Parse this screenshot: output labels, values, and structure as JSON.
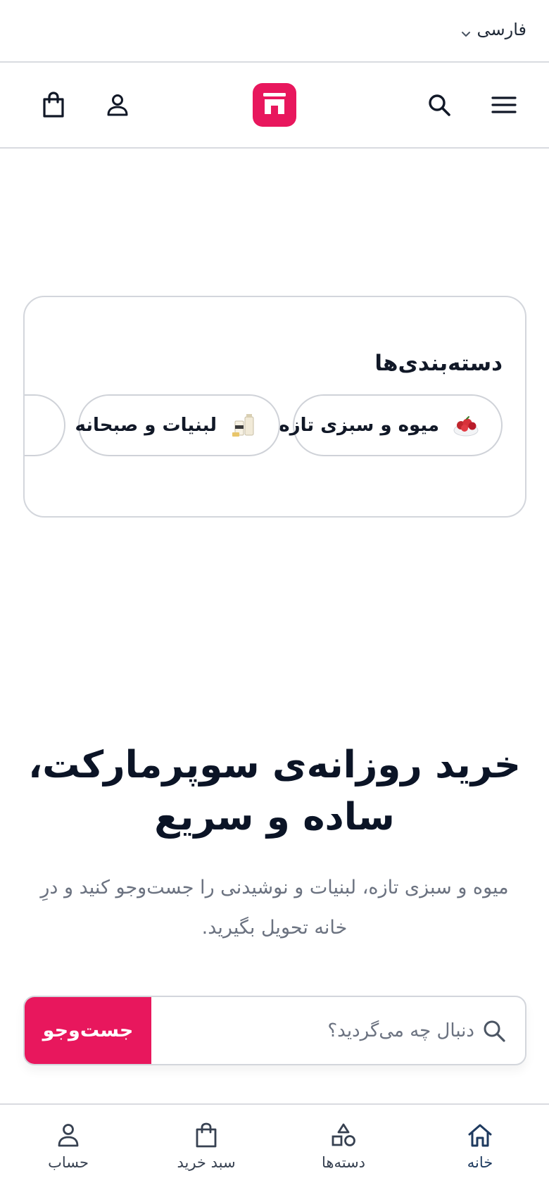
{
  "language": {
    "selected": "فارسی"
  },
  "header": {
    "brand_color": "#e8175d"
  },
  "categories": {
    "title": "دسته‌بندی‌ها",
    "items": [
      {
        "label": "میوه و سبزی تازه",
        "icon": "fruit-bowl-icon"
      },
      {
        "label": "لبنیات و صبحانه",
        "icon": "dairy-icon"
      },
      {
        "label": "",
        "icon": ""
      }
    ]
  },
  "hero": {
    "title_line1": "خرید روزانه‌ی سوپرمارکت،",
    "title_line2": "ساده و سریع",
    "subtitle_line1": "میوه و سبزی تازه، لبنیات و نوشیدنی را جست‌وجو کنید و درِ",
    "subtitle_line2": "خانه تحویل بگیرید."
  },
  "search": {
    "placeholder": "دنبال چه می‌گردید؟",
    "value": "",
    "submit_label": "جست‌وجو"
  },
  "bottom_nav": {
    "items": [
      {
        "label": "خانه",
        "icon": "home-icon",
        "active": true
      },
      {
        "label": "دسته‌ها",
        "icon": "shapes-icon",
        "active": false
      },
      {
        "label": "سبد خرید",
        "icon": "shopping-bag-icon",
        "active": false
      },
      {
        "label": "حساب",
        "icon": "user-icon",
        "active": false
      }
    ]
  }
}
